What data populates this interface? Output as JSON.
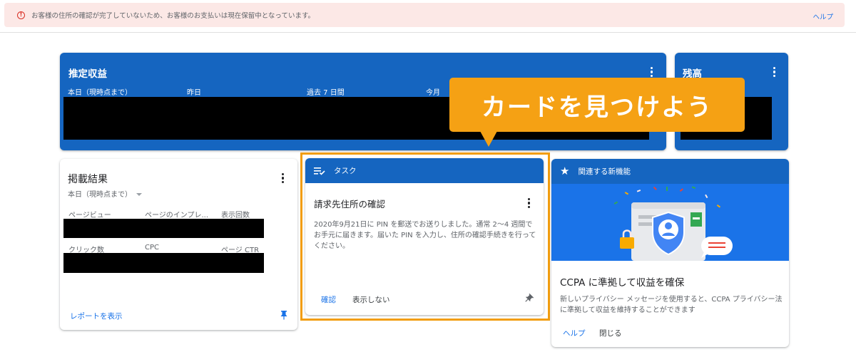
{
  "alert": {
    "message": "お客様の住所の確認が完了していないため、お客様のお支払いは現在保留中となっています。",
    "help_label": "ヘルプ",
    "icon": "error-icon"
  },
  "earnings": {
    "title": "推定収益",
    "columns": [
      "本日（現時点まで）",
      "昨日",
      "過去 7 日間",
      "今月"
    ]
  },
  "balance": {
    "title": "残高"
  },
  "performance": {
    "title": "掲載結果",
    "period": "本日（現時点まで）",
    "metrics_row1": [
      "ページビュー",
      "ページのインプレ...",
      "表示回数"
    ],
    "metrics_row2": [
      "クリック数",
      "CPC",
      "ページ CTR"
    ],
    "report_link": "レポートを表示"
  },
  "task": {
    "header": "タスク",
    "title": "請求先住所の確認",
    "body": "2020年9月21日に PIN を郵送でお送りしました。通常 2～4 週間でお手元に届きます。届いた PIN を入力し、住所の確認手続きを行ってください。",
    "confirm_label": "確認",
    "dismiss_label": "表示しない"
  },
  "new_features": {
    "header": "関連する新機能",
    "title": "CCPA に準拠して収益を確保",
    "body": "新しいプライバシー メッセージを使用すると、CCPA プライバシー法に準拠して収益を維持することができます",
    "help_label": "ヘルプ",
    "close_label": "閉じる"
  },
  "callout": {
    "text": "カードを見つけよう"
  },
  "colors": {
    "card_blue": "#1565c0",
    "accent_orange": "#f5a114",
    "link_blue": "#1a73e8",
    "alert_bg": "#fce8e6"
  }
}
